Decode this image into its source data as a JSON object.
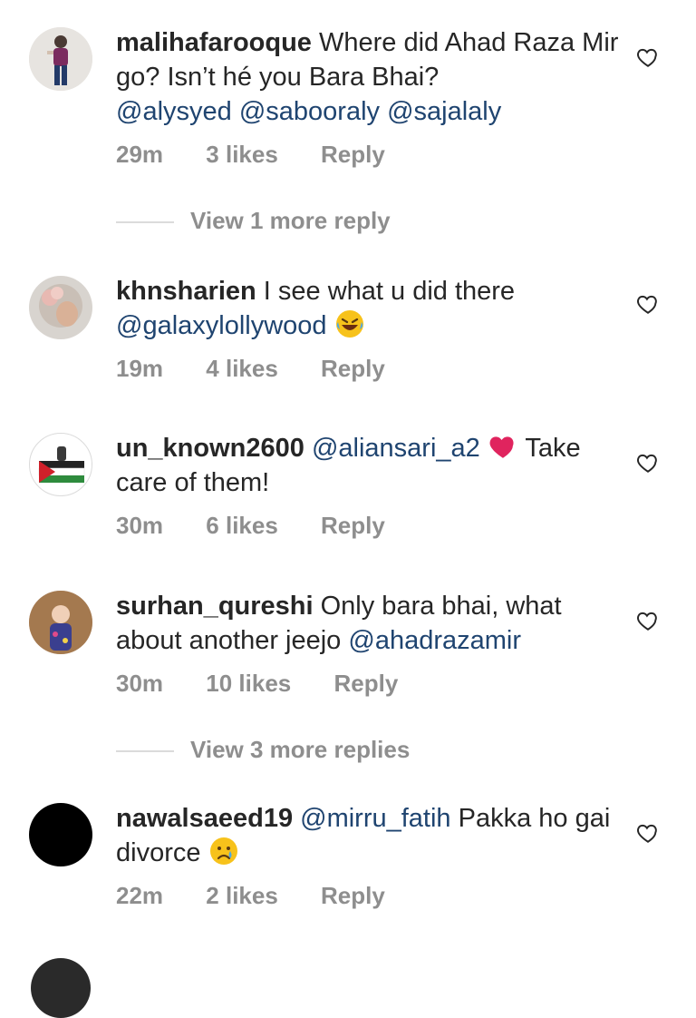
{
  "comments": [
    {
      "username": "malihafarooque",
      "text_parts": [
        "Where did Ahad Raza Mir go? Isn’t hé you Bara Bhai? "
      ],
      "mentions": [
        "@alysyed",
        "@sabooraly",
        "@sajalaly"
      ],
      "time": "29m",
      "likes": "3 likes",
      "reply": "Reply",
      "view_more": "View 1 more reply"
    },
    {
      "username": "khnsharien",
      "text": "I see what u did there",
      "mention": "@galaxylollywood",
      "emoji": "laughing-tears",
      "time": "19m",
      "likes": "4 likes",
      "reply": "Reply"
    },
    {
      "username": "un_known2600",
      "mention": "@aliansari_a2",
      "text": "Take care of them!",
      "emoji": "red-heart",
      "time": "30m",
      "likes": "6 likes",
      "reply": "Reply"
    },
    {
      "username": "surhan_qureshi",
      "text": "Only bara bhai, what about another jeejo",
      "mention": "@ahadrazamir",
      "time": "30m",
      "likes": "10 likes",
      "reply": "Reply",
      "view_more": "View 3 more replies"
    },
    {
      "username": "nawalsaeed19",
      "mention": "@mirru_fatih",
      "text": "Pakka ho gai divorce",
      "emoji": "crying-face",
      "time": "22m",
      "likes": "2 likes",
      "reply": "Reply"
    }
  ],
  "colors": {
    "mention": "#1f4470",
    "meta": "#8e8e8e",
    "text": "#262626",
    "heart_red": "#e0245e"
  }
}
